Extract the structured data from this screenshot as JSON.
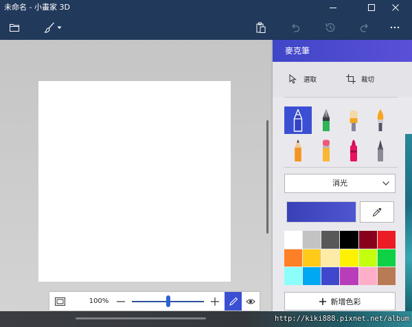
{
  "window": {
    "title": "未命名 - 小畫家 3D"
  },
  "toolbar": {
    "disabled_tools": [
      "undo-icon",
      "history-icon",
      "redo-icon"
    ]
  },
  "panel": {
    "title": "麥克筆",
    "select_label": "選取",
    "crop_label": "裁切",
    "brushes": [
      "marker-icon",
      "calligraphy-pen-icon",
      "oil-brush-icon",
      "watercolor-icon",
      "pencil-icon",
      "eraser-icon",
      "crayon-icon",
      "pixel-pen-icon"
    ],
    "selected_brush": "marker-icon",
    "finish": "消光",
    "current_color": "#3f48cc",
    "palette": [
      "#ffffff",
      "#c3c3c3",
      "#585858",
      "#000000",
      "#88001b",
      "#ec1c24",
      "#ff7f27",
      "#ffca18",
      "#fdeca6",
      "#fff200",
      "#c4ff0e",
      "#0ed145",
      "#8cfffb",
      "#00a8f3",
      "#3f48cc",
      "#b83dba",
      "#ffaec8",
      "#b97a56"
    ],
    "add_color_label": "新增色彩"
  },
  "zoom": {
    "label": "100%",
    "slider_level": 0.5
  },
  "colors": {
    "chrome": "#21395b",
    "accent": "#3b4fd3",
    "panel_header_start": "#3f46c8",
    "panel_header_end": "#5b4fd8"
  },
  "icons": {
    "title_bar": [
      "minimize-icon",
      "maximize-icon",
      "close-icon"
    ],
    "toolbar": [
      "folder-icon",
      "brush-icon",
      "chevron-down-icon",
      "paste-icon",
      "undo-icon",
      "history-icon",
      "redo-icon",
      "more-icon"
    ],
    "panel": [
      "select-icon",
      "crop-icon",
      "eyedropper-icon",
      "plus-icon"
    ],
    "zoom_bar": [
      "fit-screen-icon",
      "minus-icon",
      "plus-icon",
      "pen-icon",
      "eye-icon"
    ]
  },
  "watermark": "http://kiki888.pixnet.net/album"
}
